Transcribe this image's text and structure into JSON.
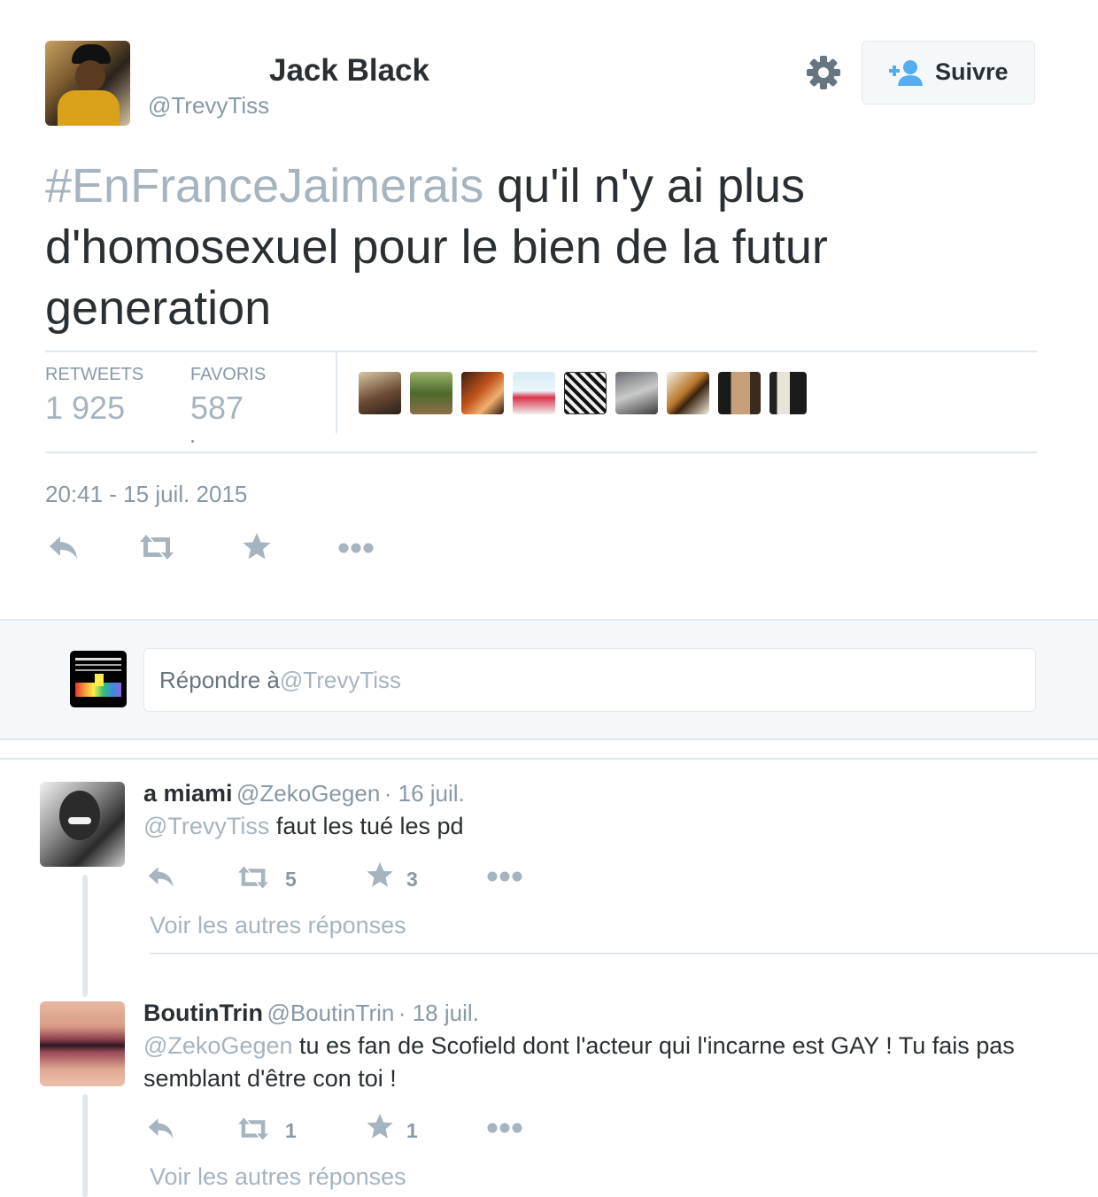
{
  "tweet": {
    "author_name": "Jack Black",
    "author_handle": "@TrevyTiss",
    "follow_label": "Suivre",
    "hashtag": "#EnFranceJaimerais",
    "text": " qu'il n'y ai plus d'homosexuel pour le bien de la futur generation",
    "retweets_label": "RETWEETS",
    "retweets_count": "1 925",
    "favorites_label": "FAVORIS",
    "favorites_count": "587",
    "timestamp": "20:41 - 15 juil. 2015",
    "icons": [
      "reply-icon",
      "retweet-icon",
      "favorite-star-icon",
      "more-dots-icon",
      "gear-icon",
      "follow-person-icon"
    ]
  },
  "reply_box": {
    "prefix": "Répondre à ",
    "mention": "@TrevyTiss"
  },
  "replies": [
    {
      "name": "a miami",
      "handle": "@ZekoGegen",
      "date": "· 16 juil.",
      "mention": "@TrevyTiss",
      "text": " faut les tué les pd",
      "retweets": "5",
      "favorites": "3",
      "more_label": "Voir les autres réponses"
    },
    {
      "name": "BoutinTrin",
      "handle": "@BoutinTrin",
      "date": "· 18 juil.",
      "mention": "@ZekoGegen",
      "text": " tu es fan de Scofield dont l'acteur qui l'incarne est GAY ! Tu fais pas semblant d'être con toi !",
      "retweets": "1",
      "favorites": "1",
      "more_label": "Voir les autres réponses"
    }
  ],
  "colors": {
    "text": "#292f33",
    "muted": "#8899a6",
    "light": "#a6b4bf",
    "border": "#e1e8ed",
    "follow_icon": "#55acee"
  }
}
